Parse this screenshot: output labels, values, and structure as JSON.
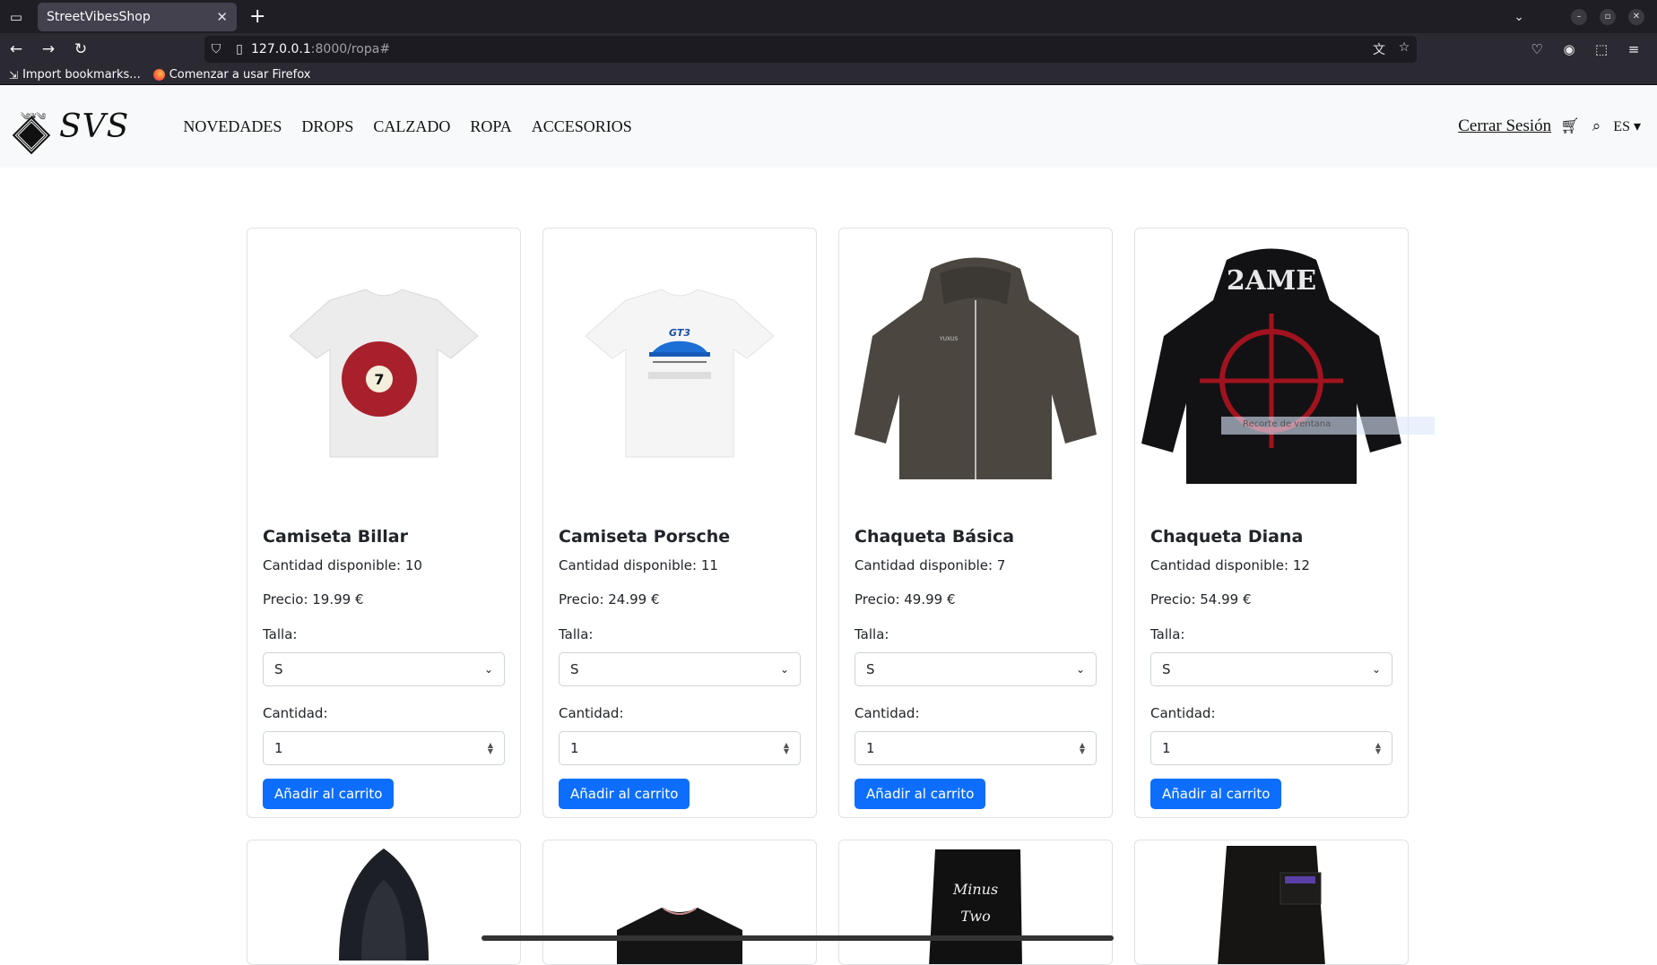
{
  "browser": {
    "tab_title": "StreetVibesShop",
    "url_host": "127.0.0.1",
    "url_path": ":8000/ropa#",
    "bookmarks": [
      "Import bookmarks...",
      "Comenzar a usar Firefox"
    ]
  },
  "header": {
    "logo_text": "SVS",
    "nav": [
      "NOVEDADES",
      "DROPS",
      "CALZADO",
      "ROPA",
      "ACCESORIOS"
    ],
    "logout": "Cerrar Sesión",
    "lang": "ES"
  },
  "labels": {
    "qty_prefix": "Cantidad disponible:",
    "price_prefix": "Precio:",
    "size_label": "Talla:",
    "amount_label": "Cantidad:",
    "add_button": "Añadir al carrito"
  },
  "products": [
    {
      "name": "Camiseta Billar",
      "qty": "Cantidad disponible: 10",
      "price": "Precio: 19.99 €",
      "size": "S",
      "amount": "1"
    },
    {
      "name": "Camiseta Porsche",
      "qty": "Cantidad disponible: 11",
      "price": "Precio: 24.99 €",
      "size": "S",
      "amount": "1"
    },
    {
      "name": "Chaqueta Básica",
      "qty": "Cantidad disponible: 7",
      "price": "Precio: 49.99 €",
      "size": "S",
      "amount": "1"
    },
    {
      "name": "Chaqueta Diana",
      "qty": "Cantidad disponible: 12",
      "price": "Precio: 54.99 €",
      "size": "S",
      "amount": "1"
    }
  ],
  "tooltip": "Recorte de ventana"
}
